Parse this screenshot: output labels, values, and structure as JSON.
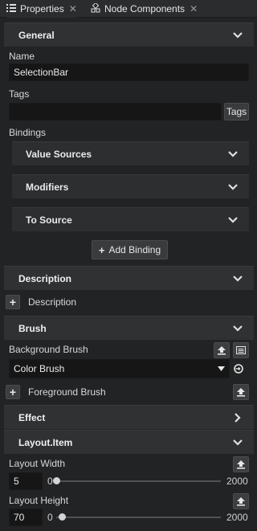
{
  "tabs": [
    {
      "label": "Properties",
      "icon": "list-icon"
    },
    {
      "label": "Node Components",
      "icon": "nodes-icon"
    }
  ],
  "general": {
    "title": "General",
    "name_label": "Name",
    "name_value": "SelectionBar",
    "tags_label": "Tags",
    "tags_value": "",
    "tags_button": "Tags",
    "bindings_label": "Bindings",
    "binding_groups": [
      "Value Sources",
      "Modifiers",
      "To Source"
    ],
    "add_binding": "Add Binding"
  },
  "description": {
    "title": "Description",
    "add_label": "Description"
  },
  "brush": {
    "title": "Brush",
    "background_label": "Background Brush",
    "background_value": "Color Brush",
    "foreground_label": "Foreground Brush"
  },
  "effect": {
    "title": "Effect"
  },
  "layout_item": {
    "title": "Layout.Item",
    "width": {
      "label": "Layout Width",
      "value": "5",
      "min": "0",
      "max": "2000",
      "fraction": 0.0025
    },
    "height": {
      "label": "Layout Height",
      "value": "70",
      "min": "0",
      "max": "2000",
      "fraction": 0.035
    }
  }
}
